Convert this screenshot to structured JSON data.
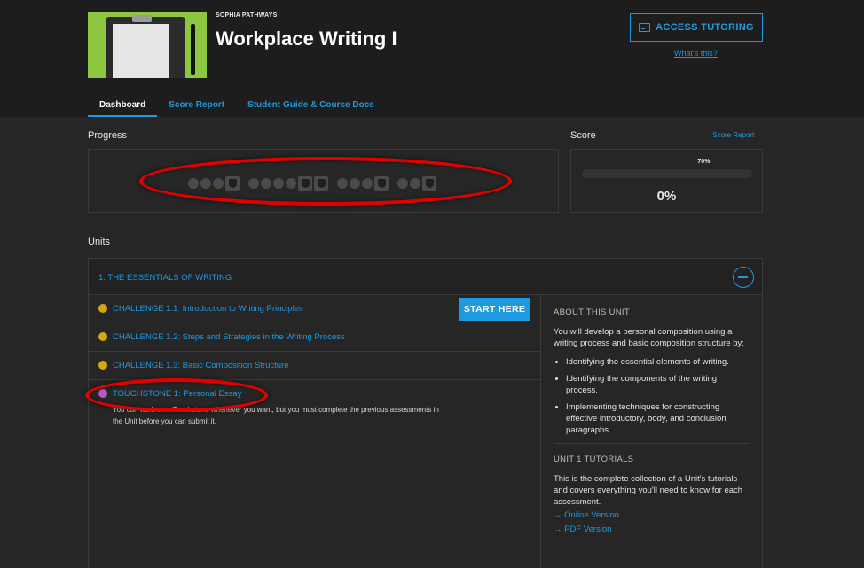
{
  "header": {
    "brand": "SOPHIA PATHWAYS",
    "course_title": "Workplace Writing I",
    "access_tutoring": "ACCESS TUTORING",
    "whats_this": "What's this?"
  },
  "tabs": [
    {
      "label": "Dashboard",
      "active": true
    },
    {
      "label": "Score Report",
      "active": false
    },
    {
      "label": "Student Guide & Course Docs",
      "active": false
    }
  ],
  "progress": {
    "label": "Progress",
    "groups": [
      {
        "challenges": 3,
        "touchstones": 1
      },
      {
        "challenges": 4,
        "touchstones": 2
      },
      {
        "challenges": 3,
        "touchstones": 1
      },
      {
        "challenges": 2,
        "touchstones": 1
      }
    ]
  },
  "score": {
    "label": "Score",
    "score_report_link": "Score Report",
    "marker": "70%",
    "marker_fraction": 0.7,
    "value": "0%"
  },
  "units": {
    "label": "Units",
    "unit1": {
      "title": "1. THE ESSENTIALS OF WRITING",
      "items": [
        {
          "label": "CHALLENGE 1.1: Introduction to Writing Principles",
          "type": "challenge"
        },
        {
          "label": "CHALLENGE 1.2: Steps and Strategies in the Writing Process",
          "type": "challenge"
        },
        {
          "label": "CHALLENGE 1.3: Basic Composition Structure",
          "type": "challenge"
        },
        {
          "label": "TOUCHSTONE 1: Personal Essay",
          "type": "touchstone"
        }
      ],
      "start_here": "START HERE",
      "touchstone_note": "You can work on a Touchstone whenever you want, but you must complete the previous assessments in the Unit before you can submit it.",
      "about": {
        "heading": "ABOUT THIS UNIT",
        "text": "You will develop a personal composition using a writing process and basic composition structure by:",
        "bullets": [
          "Identifying the essential elements of writing.",
          "Identifying the components of the writing process.",
          "Implementing techniques for constructing effective introductory, body, and conclusion paragraphs."
        ]
      },
      "tutorials": {
        "heading": "UNIT 1 TUTORIALS",
        "text": "This is the complete collection of a Unit's tutorials and covers everything you'll need to know for each assessment.",
        "online": "Online Version",
        "pdf": "PDF Version"
      }
    }
  },
  "colors": {
    "accent": "#1e9be0",
    "challenge_dot": "#d4a80a",
    "touchstone_dot": "#b45cc4",
    "annotation": "#e00000"
  }
}
